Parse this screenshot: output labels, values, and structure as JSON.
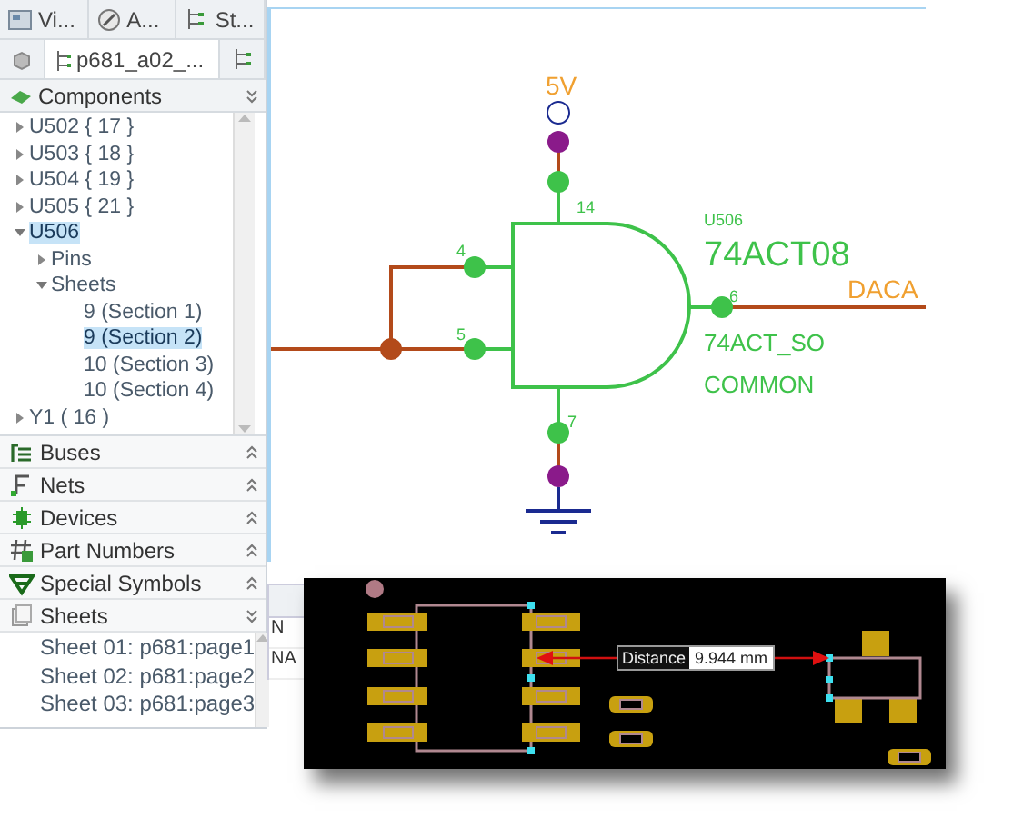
{
  "panel_tabs": [
    {
      "label": "Vi...",
      "kind": "view",
      "selected": false
    },
    {
      "label": "A...",
      "kind": "edit",
      "selected": false
    },
    {
      "label": "St...",
      "kind": "tree",
      "selected": false
    }
  ],
  "document_tabs": [
    {
      "label": "p681_a02_...",
      "selected": true
    }
  ],
  "components": {
    "title": "Components",
    "expanded": true,
    "tree": [
      {
        "label": "U502 { 17 }",
        "expanded": false,
        "selected": false
      },
      {
        "label": "U503 { 18 }",
        "expanded": false,
        "selected": false
      },
      {
        "label": "U504 { 19 }",
        "expanded": false,
        "selected": false
      },
      {
        "label": "U505 { 21 }",
        "expanded": false,
        "selected": false
      },
      {
        "label": "U506",
        "expanded": true,
        "selected": true,
        "children": [
          {
            "label": "Pins",
            "expanded": false,
            "selected": false
          },
          {
            "label": "Sheets",
            "expanded": true,
            "selected": false,
            "children": [
              {
                "label": "9 (Section 1)",
                "selected": false
              },
              {
                "label": "9 (Section 2)",
                "selected": true
              },
              {
                "label": "10 (Section 3)",
                "selected": false
              },
              {
                "label": "10 (Section 4)",
                "selected": false
              }
            ]
          }
        ]
      },
      {
        "label": "Y1 ( 16 )",
        "expanded": false,
        "selected": false
      }
    ]
  },
  "sections": [
    {
      "label": "Buses",
      "kind": "buses",
      "expanded": false
    },
    {
      "label": "Nets",
      "kind": "nets",
      "expanded": false
    },
    {
      "label": "Devices",
      "kind": "devices",
      "expanded": false
    },
    {
      "label": "Part Numbers",
      "kind": "parts",
      "expanded": false
    },
    {
      "label": "Special Symbols",
      "kind": "symbols",
      "expanded": false
    },
    {
      "label": "Sheets",
      "kind": "sheets",
      "expanded": true
    }
  ],
  "sheets": [
    "Sheet 01: p681:page1",
    "Sheet 02: p681:page2",
    "Sheet 03: p681:page3"
  ],
  "schematic": {
    "power_label": "5V",
    "ref": "U506",
    "part": "74ACT08",
    "package": "74ACT_SO",
    "variant": "COMMON",
    "net_label": "DACA",
    "pins": [
      "14",
      "4",
      "5",
      "6",
      "7"
    ]
  },
  "lower_panel_rows": [
    "N",
    "NA"
  ],
  "pcb": {
    "measure_label": "Distance",
    "measure_value": "9.944 mm"
  }
}
